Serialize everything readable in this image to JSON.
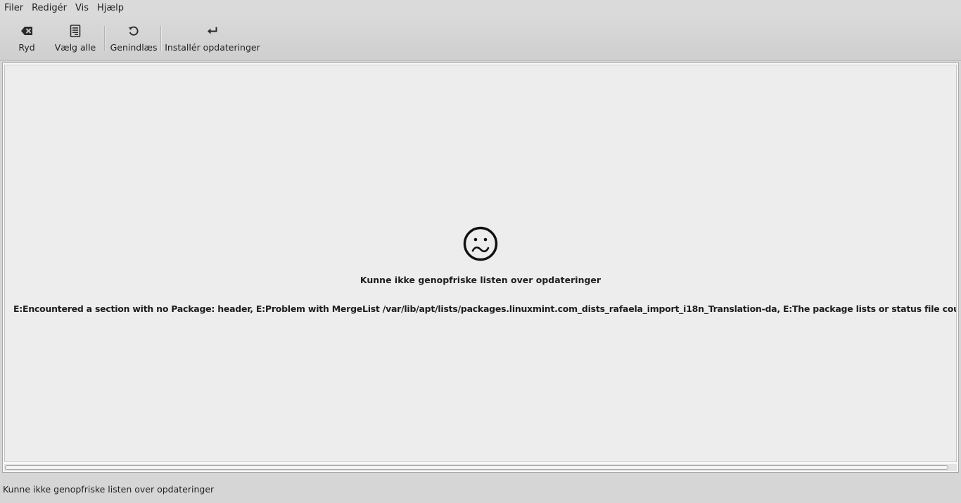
{
  "menubar": {
    "items": [
      {
        "label": "Filer"
      },
      {
        "label": "Redigér"
      },
      {
        "label": "Vis"
      },
      {
        "label": "Hjælp"
      }
    ]
  },
  "toolbar": {
    "clear_label": "Ryd",
    "clear_icon": "backspace-icon",
    "select_all_label": "Vælg alle",
    "select_all_icon": "document-list-icon",
    "refresh_label": "Genindlæs",
    "refresh_icon": "refresh-icon",
    "install_label": "Installér opdateringer",
    "install_icon": "return-arrow-icon"
  },
  "main": {
    "error_icon": "sad-face-icon",
    "error_title": "Kunne ikke genopfriske listen over opdateringer",
    "error_detail": "E:Encountered a section with no Package: header, E:Problem with MergeList /var/lib/apt/lists/packages.linuxmint.com_dists_rafaela_import_i18n_Translation-da, E:The package lists or status file could not be parsed or opened."
  },
  "statusbar": {
    "text": "Kunne ikke genopfriske listen over opdateringer"
  },
  "colors": {
    "background": "#d6d6d6",
    "content_bg": "#ededed",
    "text": "#222222"
  }
}
